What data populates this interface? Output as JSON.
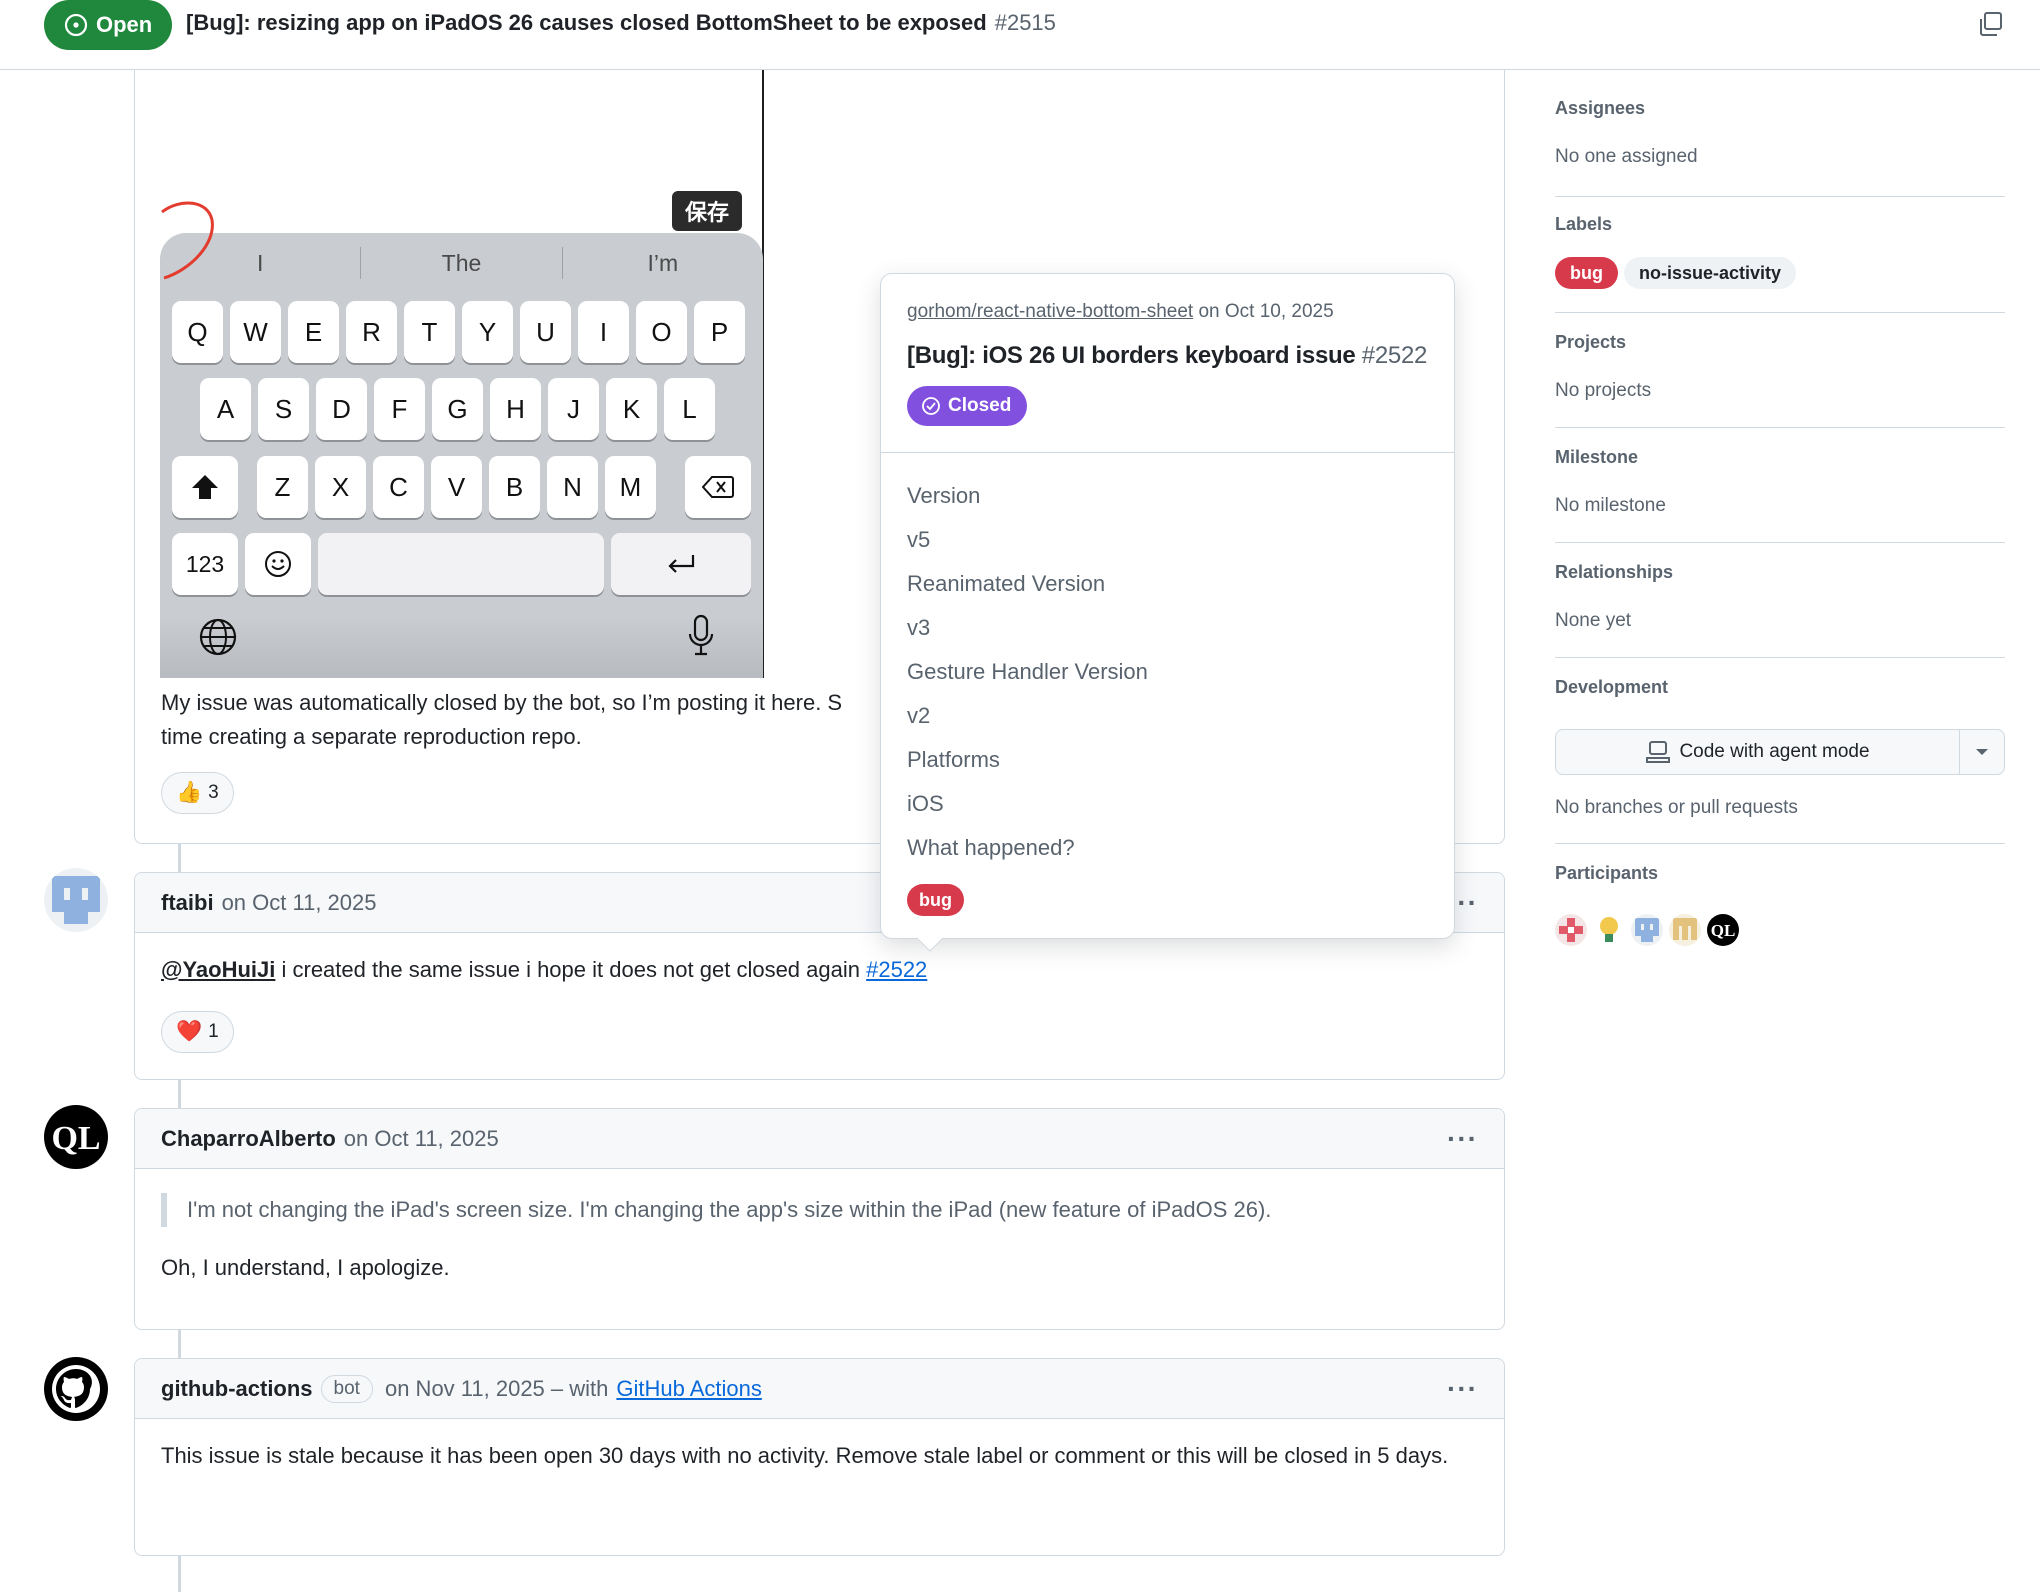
{
  "header": {
    "state": "Open",
    "title": "[Bug]: resizing app on iPadOS 26 causes closed BottomSheet to be exposed",
    "number": "#2515"
  },
  "first_comment": {
    "image": {
      "save_badge": "保存",
      "suggestions": [
        "I",
        "The",
        "I’m"
      ],
      "row1": [
        "Q",
        "W",
        "E",
        "R",
        "T",
        "Y",
        "U",
        "I",
        "O",
        "P"
      ],
      "row2": [
        "A",
        "S",
        "D",
        "F",
        "G",
        "H",
        "J",
        "K",
        "L"
      ],
      "row3": [
        "Z",
        "X",
        "C",
        "V",
        "B",
        "N",
        "M"
      ],
      "numbers_key": "123"
    },
    "text_line1": "My issue was automatically closed by the bot, so I’m posting it here. S",
    "text_line2": "time creating a separate reproduction repo.",
    "reaction_emoji": "👍",
    "reaction_count": "3"
  },
  "hovercard": {
    "repo": "gorhom/react-native-bottom-sheet",
    "date": "on Oct 10, 2025",
    "title": "[Bug]: iOS 26 UI borders keyboard issue",
    "number": "#2522",
    "state": "Closed",
    "fields": [
      "Version",
      "v5",
      "Reanimated Version",
      "v3",
      "Gesture Handler Version",
      "v2",
      "Platforms",
      "iOS",
      "What happened?"
    ],
    "label": "bug"
  },
  "comments": [
    {
      "author": "ftaibi",
      "date": "on Oct 11, 2025",
      "mention": "@YaoHuiJi",
      "text": "i created the same issue i hope it does not get closed again",
      "link": "#2522",
      "reaction_emoji": "❤️",
      "reaction_count": "1"
    },
    {
      "author": "ChaparroAlberto",
      "date": "on Oct 11, 2025",
      "quote": "I'm not changing the iPad's screen size. I'm changing the app's size within the iPad (new feature of iPadOS 26).",
      "text": "Oh, I understand, I apologize."
    },
    {
      "author": "github-actions",
      "badge": "bot",
      "date": "on Nov 11, 2025 – with",
      "app_link": "GitHub Actions",
      "text": "This issue is stale because it has been open 30 days with no activity. Remove stale label or comment or this will be closed in 5 days."
    }
  ],
  "sidebar": {
    "assignees": {
      "heading": "Assignees",
      "value": "No one assigned"
    },
    "labels": {
      "heading": "Labels",
      "items": [
        {
          "name": "bug",
          "color": "#d73a4a",
          "text_color": "#ffffff"
        },
        {
          "name": "no-issue-activity",
          "color": "#eff2f5",
          "text_color": "#1f2328"
        }
      ]
    },
    "projects": {
      "heading": "Projects",
      "value": "No projects"
    },
    "milestone": {
      "heading": "Milestone",
      "value": "No milestone"
    },
    "relationships": {
      "heading": "Relationships",
      "value": "None yet"
    },
    "development": {
      "heading": "Development",
      "button": "Code with agent mode",
      "value": "No branches or pull requests"
    },
    "participants": {
      "heading": "Participants",
      "count": 5
    }
  },
  "colors": {
    "open": "#1f883d",
    "closed": "#8250df",
    "link": "#0969da",
    "bug": "#d73a4a"
  }
}
